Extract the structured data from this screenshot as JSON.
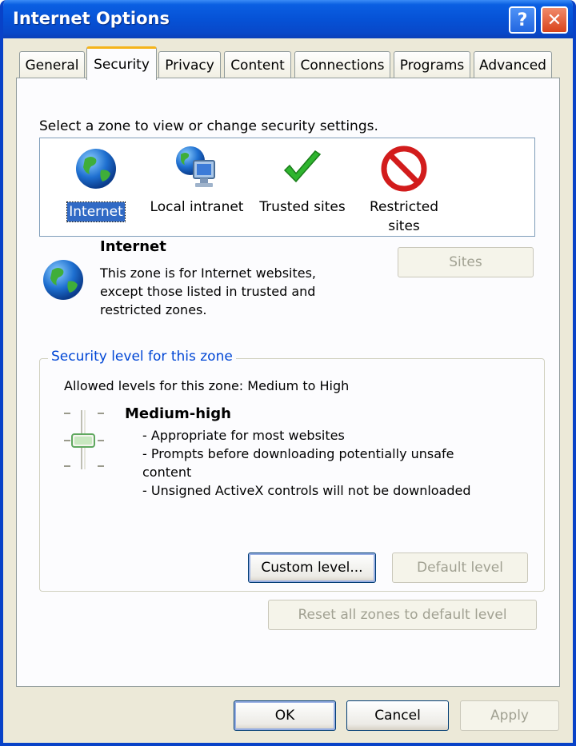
{
  "window": {
    "title": "Internet Options",
    "help_label": "?",
    "close_label": "✕"
  },
  "tabs": [
    {
      "label": "General"
    },
    {
      "label": "Security"
    },
    {
      "label": "Privacy"
    },
    {
      "label": "Content"
    },
    {
      "label": "Connections"
    },
    {
      "label": "Programs"
    },
    {
      "label": "Advanced"
    }
  ],
  "active_tab": "Security",
  "zones": {
    "prompt": "Select a zone to view or change security settings.",
    "items": [
      {
        "label": "Internet",
        "icon": "globe-icon",
        "selected": true
      },
      {
        "label": "Local intranet",
        "icon": "intranet-icon"
      },
      {
        "label": "Trusted sites",
        "icon": "checkmark-icon"
      },
      {
        "label": "Restricted",
        "label2": "sites",
        "icon": "restricted-icon"
      }
    ]
  },
  "zone_info": {
    "title": "Internet",
    "description": "This zone is for Internet websites, except those listed in trusted and restricted zones.",
    "sites_button": "Sites"
  },
  "security_level": {
    "group_label": "Security level for this zone",
    "allowed": "Allowed levels for this zone: Medium to High",
    "level_name": "Medium-high",
    "bullets": [
      "- Appropriate for most websites",
      "- Prompts before downloading potentially unsafe content",
      "- Unsigned ActiveX controls will not be downloaded"
    ],
    "custom_button": "Custom level...",
    "default_button": "Default level"
  },
  "reset_button": "Reset all zones to default level",
  "footer": {
    "ok": "OK",
    "cancel": "Cancel",
    "apply": "Apply"
  },
  "colors": {
    "titlebar": "#0652d6",
    "selection": "#316ac5",
    "group_label": "#0046d5",
    "disabled_text": "#a1a192"
  }
}
